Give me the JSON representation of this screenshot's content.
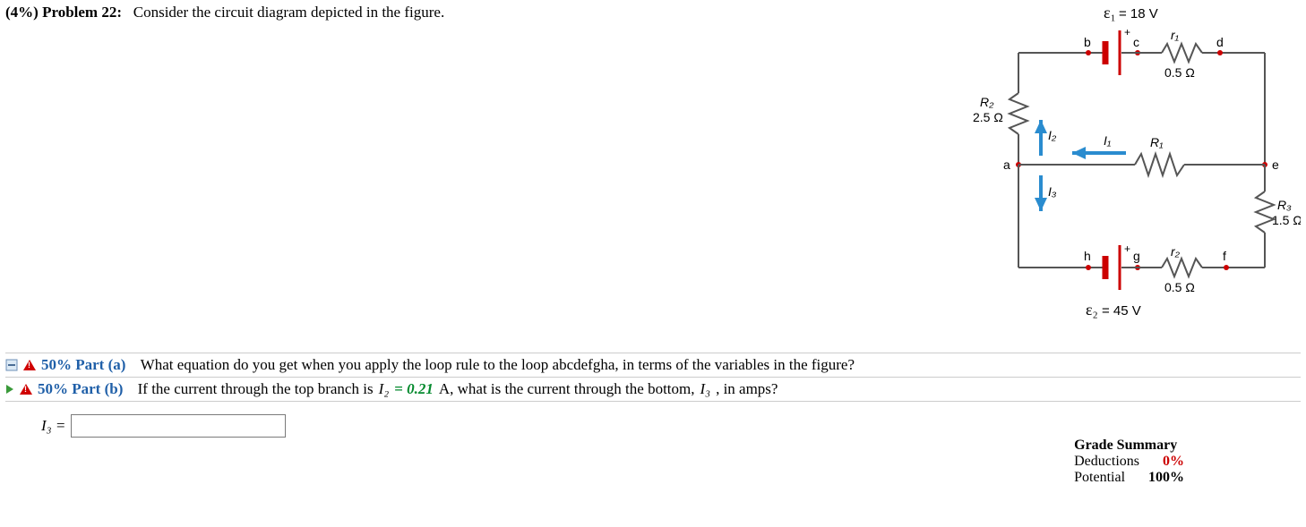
{
  "problem": {
    "weight": "(4%)",
    "label": "Problem 22:",
    "text": "Consider the circuit diagram depicted in the figure."
  },
  "circuit": {
    "E1_label": "ε₁",
    "E1_value": "= 18 V",
    "E1_plus": "+",
    "node_a": "a",
    "node_b": "b",
    "node_c": "c",
    "node_d": "d",
    "node_e": "e",
    "node_f": "f",
    "node_g": "g",
    "node_h": "h",
    "R2_name": "R₂",
    "R2_value": "2.5 Ω",
    "r1_name": "r₁",
    "r1_value": "0.5 Ω",
    "R1_name": "R₁",
    "I1": "I₁",
    "I2": "I₂",
    "I3": "I₃",
    "R3_name": "R₃",
    "R3_value": "1.5 Ω",
    "r2_name": "r₂",
    "r2_value": "0.5 Ω",
    "E2_label": "ε₂",
    "E2_value": "= 45 V",
    "E2_plus": "+"
  },
  "parts": {
    "a": {
      "label": "50% Part (a)",
      "text": "What equation do you get when you apply the loop rule to the loop abcdefgha, in terms of the variables in the figure?"
    },
    "b": {
      "label": "50% Part (b)",
      "text_pre": "If the current through the top branch is ",
      "I2_label": "I₂",
      "given": " = 0.21 ",
      "text_mid": "A, what is the current through the bottom, ",
      "I3_label": "I₃",
      "text_post": ", in amps?"
    }
  },
  "answer": {
    "lhs": "I₃ ="
  },
  "grade": {
    "title": "Grade Summary",
    "deduct_label": "Deductions",
    "deduct_value": "0%",
    "potential_label": "Potential",
    "potential_value": "100%"
  }
}
